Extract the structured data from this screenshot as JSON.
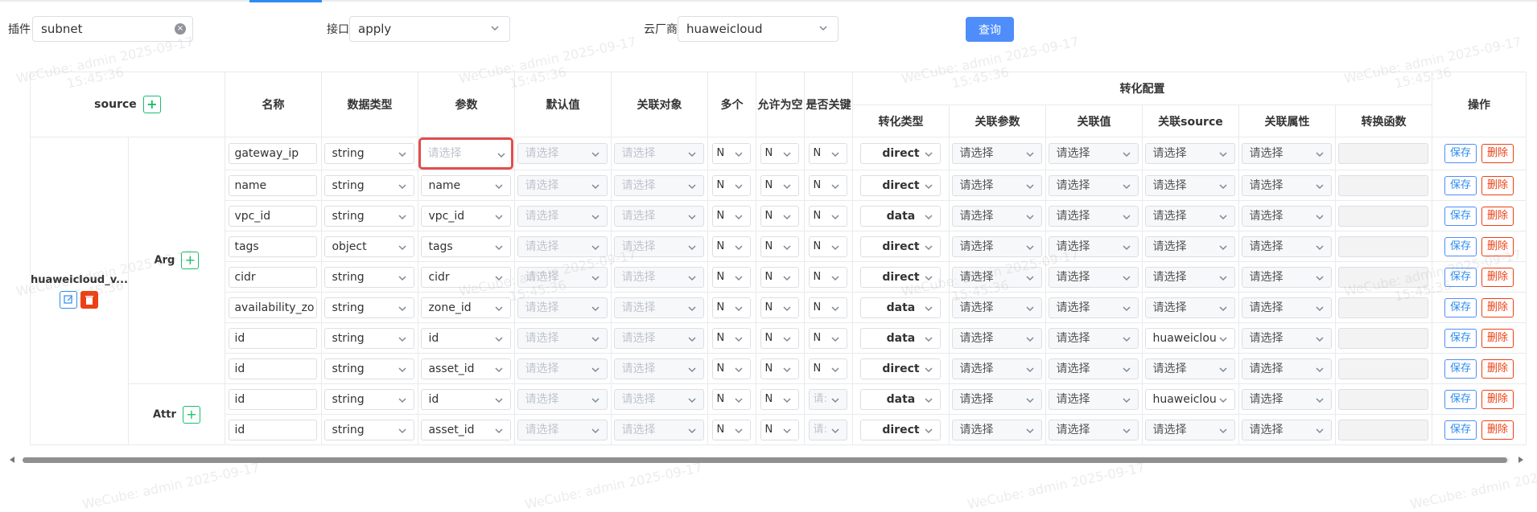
{
  "filters": {
    "plugin_label": "插件",
    "plugin_value": "subnet",
    "interface_label": "接口",
    "interface_value": "apply",
    "cloud_label": "云厂商",
    "cloud_value": "huaweicloud",
    "query_label": "查询"
  },
  "headers": {
    "source": "source",
    "name": "名称",
    "data_type": "数据类型",
    "param": "参数",
    "default": "默认值",
    "related_object": "关联对象",
    "multiple": "多个",
    "nullable": "允许为空",
    "is_key": "是否关键",
    "transform": "转化配置",
    "transform_type": "转化类型",
    "related_param": "关联参数",
    "related_value": "关联值",
    "related_source": "关联source",
    "related_attr": "关联属性",
    "convert_func": "转换函数",
    "ops": "操作"
  },
  "source_name": "huaweicloud_v...",
  "group_labels": {
    "arg": "Arg",
    "attr": "Attr"
  },
  "placeholder": "请选择",
  "actions": {
    "save": "保存",
    "delete": "删除"
  },
  "rows": [
    {
      "name": "gateway_ip",
      "type": "string",
      "param": "请选择",
      "multi": "N",
      "nullable": "N",
      "key": "N",
      "ttype": "direct",
      "rsource": "请选择"
    },
    {
      "name": "name",
      "type": "string",
      "param": "name",
      "multi": "N",
      "nullable": "N",
      "key": "N",
      "ttype": "direct",
      "rsource": "请选择"
    },
    {
      "name": "vpc_id",
      "type": "string",
      "param": "vpc_id",
      "multi": "N",
      "nullable": "N",
      "key": "N",
      "ttype": "data",
      "rsource": "请选择"
    },
    {
      "name": "tags",
      "type": "object",
      "param": "tags",
      "multi": "N",
      "nullable": "N",
      "key": "N",
      "ttype": "direct",
      "rsource": "请选择"
    },
    {
      "name": "cidr",
      "type": "string",
      "param": "cidr",
      "multi": "N",
      "nullable": "N",
      "key": "N",
      "ttype": "direct",
      "rsource": "请选择"
    },
    {
      "name": "availability_zo",
      "type": "string",
      "param": "zone_id",
      "multi": "N",
      "nullable": "N",
      "key": "N",
      "ttype": "data",
      "rsource": "请选择"
    },
    {
      "name": "id",
      "type": "string",
      "param": "id",
      "multi": "N",
      "nullable": "N",
      "key": "N",
      "ttype": "data",
      "rsource": "huaweiclou"
    },
    {
      "name": "id",
      "type": "string",
      "param": "asset_id",
      "multi": "N",
      "nullable": "N",
      "key": "N",
      "ttype": "direct",
      "rsource": "请选择"
    },
    {
      "name": "id",
      "type": "string",
      "param": "id",
      "multi": "N",
      "nullable": "N",
      "key": "请:",
      "ttype": "data",
      "rsource": "huaweiclou"
    },
    {
      "name": "id",
      "type": "string",
      "param": "asset_id",
      "multi": "N",
      "nullable": "N",
      "key": "请:",
      "ttype": "direct",
      "rsource": "请选择"
    }
  ],
  "watermark": {
    "line1": "WeCube: admin 2025-09-17",
    "line2": "15:45:36"
  }
}
